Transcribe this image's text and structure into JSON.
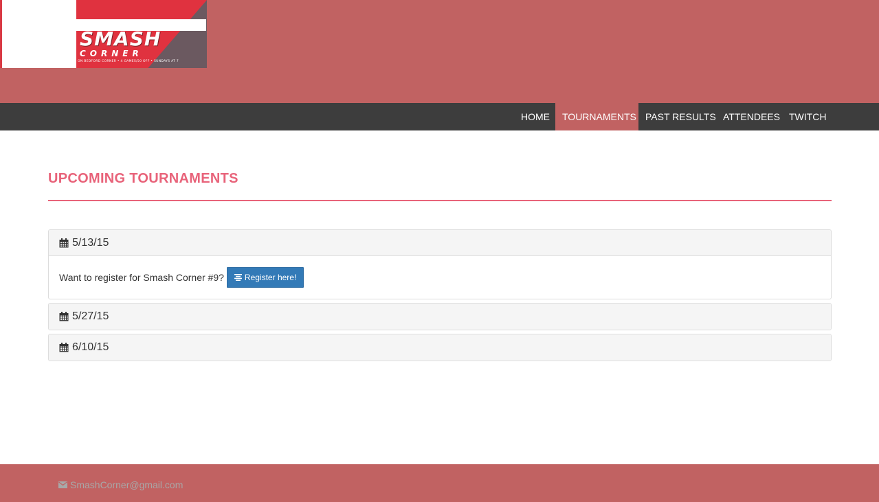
{
  "brand": {
    "logo_title": "SMASH",
    "logo_subtitle": "CORNER",
    "logo_tagline": "ON BEDFORD CORNER  •  4 GAMES/50 OFF  •  SUNDAYS AT 7"
  },
  "nav": {
    "items": [
      {
        "label": "HOME"
      },
      {
        "label": "TOURNAMENTS"
      },
      {
        "label": "PAST RESULTS"
      },
      {
        "label": "ATTENDEES"
      },
      {
        "label": "TWITCH"
      }
    ],
    "active": "TOURNAMENTS"
  },
  "main": {
    "title": "UPCOMING TOURNAMENTS",
    "tournaments": [
      {
        "date": "5/13/15",
        "expanded": true,
        "body_text": "Want to register for Smash Corner #9?",
        "button_label": "Register here!"
      },
      {
        "date": "5/27/15",
        "expanded": false
      },
      {
        "date": "6/10/15",
        "expanded": false
      }
    ]
  },
  "footer": {
    "email": "SmashCorner@gmail.com"
  },
  "colors": {
    "header_bg": "#c16262",
    "navbar_bg": "#3d3d3d",
    "accent": "#e8637a",
    "button_primary": "#337ab7",
    "footer_text": "#a8a8a8"
  },
  "icons": {
    "date": "calendar-icon",
    "register": "list-icon",
    "email": "envelope-icon"
  }
}
